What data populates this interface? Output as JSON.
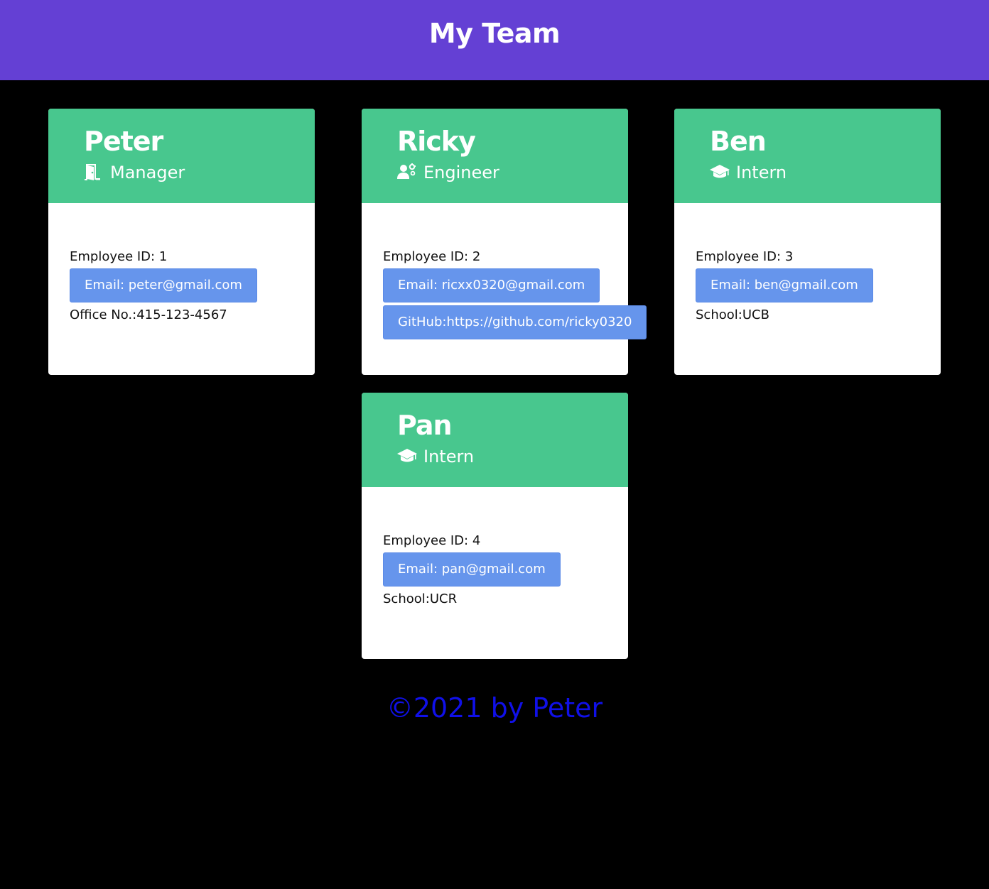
{
  "header": {
    "title": "My Team"
  },
  "cards": [
    {
      "name": "Peter",
      "role": "Manager",
      "role_icon": "door-icon",
      "id_text": "Employee ID: 1",
      "email_label": "Email: peter@gmail.com",
      "extra": "Office No.:415-123-4567"
    },
    {
      "name": "Ricky",
      "role": "Engineer",
      "role_icon": "engineer-icon",
      "id_text": "Employee ID: 2",
      "email_label": "Email: ricxx0320@gmail.com",
      "github_label": "GitHub:https://github.com/ricky0320"
    },
    {
      "name": "Ben",
      "role": "Intern",
      "role_icon": "graduation-cap-icon",
      "id_text": "Employee ID: 3",
      "email_label": "Email: ben@gmail.com",
      "extra": "School:UCB"
    },
    {
      "name": "Pan",
      "role": "Intern",
      "role_icon": "graduation-cap-icon",
      "id_text": "Employee ID: 4",
      "email_label": "Email: pan@gmail.com",
      "extra": "School:UCR"
    }
  ],
  "footer": {
    "text": "©2021 by Peter"
  },
  "colors": {
    "header_bg": "#6440d4",
    "card_head_bg": "#48c78e",
    "button_bg": "#6695ec",
    "footer_text": "#1010e8",
    "page_bg": "#000000"
  }
}
